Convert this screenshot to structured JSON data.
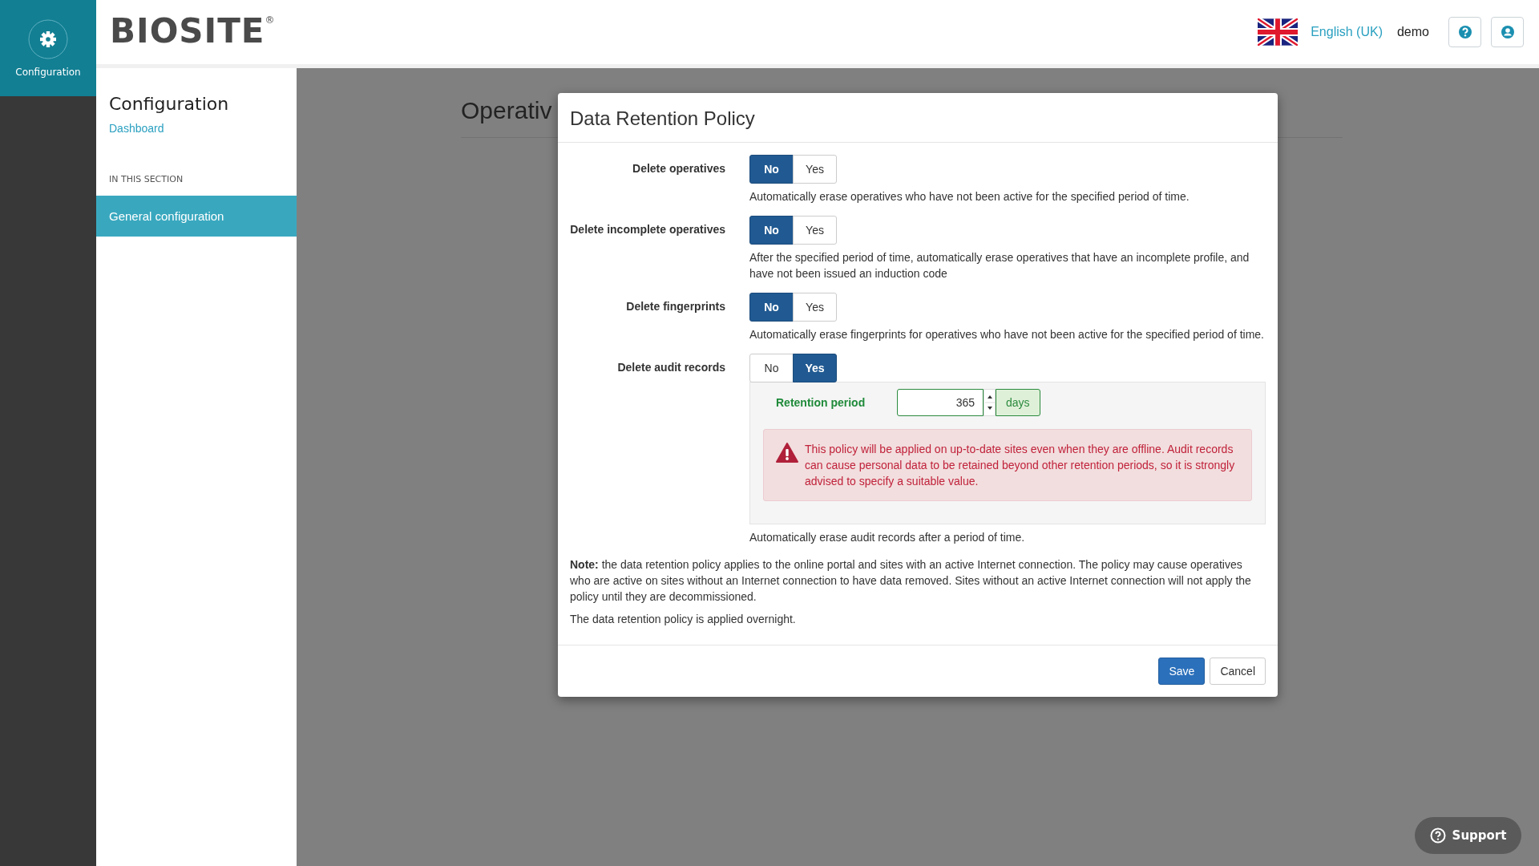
{
  "rail": {
    "label": "Configuration"
  },
  "header": {
    "logo": "BIOSITE",
    "logo_mark": "®",
    "language": "English (UK)",
    "user": "demo"
  },
  "sidebar": {
    "title": "Configuration",
    "link": "Dashboard",
    "section_heading": "IN THIS SECTION",
    "items": [
      {
        "label": "General configuration",
        "selected": true
      }
    ]
  },
  "page": {
    "heading": "Operativ"
  },
  "modal": {
    "title": "Data Retention Policy",
    "settings": [
      {
        "label": "Delete operatives",
        "options": [
          {
            "label": "No",
            "selected": true
          },
          {
            "label": "Yes",
            "selected": false
          }
        ],
        "help": "Automatically erase operatives who have not been active for the specified period of time."
      },
      {
        "label": "Delete incomplete operatives",
        "options": [
          {
            "label": "No",
            "selected": true
          },
          {
            "label": "Yes",
            "selected": false
          }
        ],
        "help": "After the specified period of time, automatically erase operatives that have an incomplete profile, and have not been issued an induction code"
      },
      {
        "label": "Delete fingerprints",
        "options": [
          {
            "label": "No",
            "selected": true
          },
          {
            "label": "Yes",
            "selected": false
          }
        ],
        "help": "Automatically erase fingerprints for operatives who have not been active for the specified period of time."
      },
      {
        "label": "Delete audit records",
        "options": [
          {
            "label": "No",
            "selected": false
          },
          {
            "label": "Yes",
            "selected": true
          }
        ],
        "retention": {
          "label": "Retention period",
          "value": "365",
          "unit": "days",
          "warning": "This policy will be applied on up-to-date sites even when they are offline. Audit records can cause personal data to be retained beyond other retention periods, so it is strongly advised to specify a suitable value."
        },
        "help": "Automatically erase audit records after a period of time."
      }
    ],
    "note": "**Note:** the data retention policy applies to the online portal and sites with an active Internet connection. The policy may cause operatives who are active on sites without an Internet connection to have data removed. Sites without an active Internet connection will not apply the policy until they are decommissioned.",
    "footer_note": "The data retention policy is applied overnight.",
    "buttons": [
      {
        "label": "Save",
        "kind": "primary"
      },
      {
        "label": "Cancel",
        "kind": "default"
      }
    ]
  },
  "support": {
    "label": "Support"
  }
}
